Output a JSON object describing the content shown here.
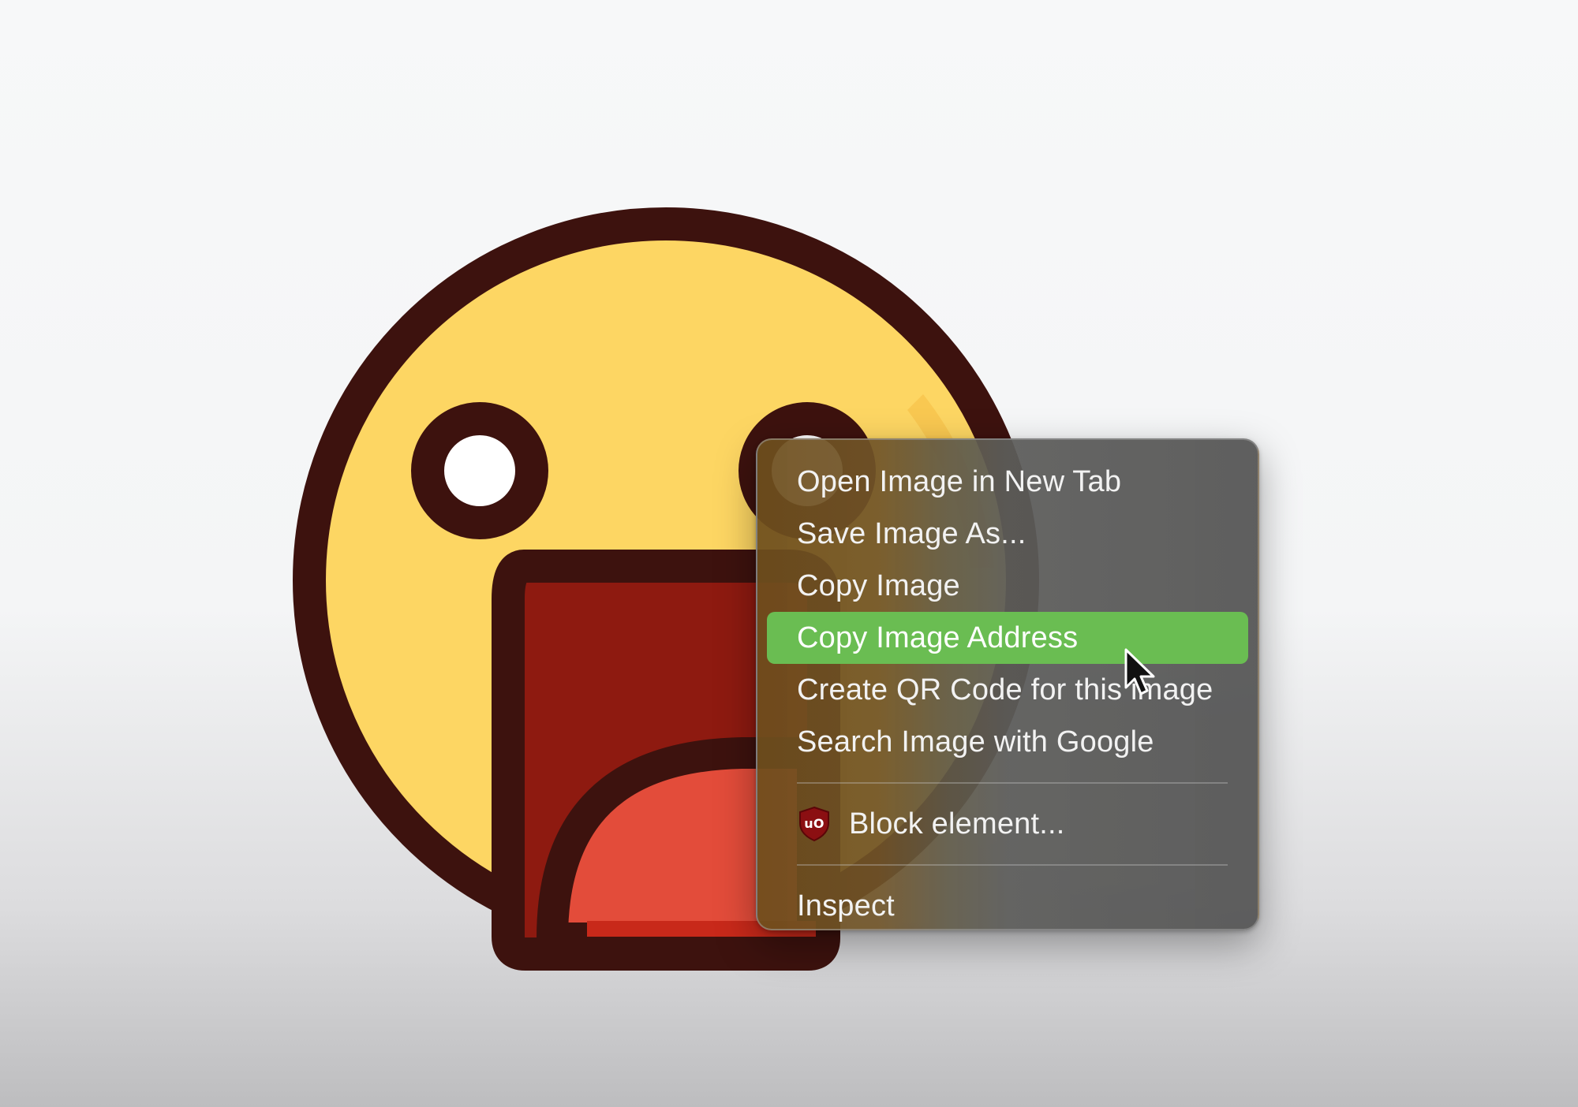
{
  "context_menu": {
    "items": [
      {
        "label": "Open Image in New Tab"
      },
      {
        "label": "Save Image As..."
      },
      {
        "label": "Copy Image"
      },
      {
        "label": "Copy Image Address",
        "highlighted": true
      },
      {
        "label": "Create QR Code for this image"
      },
      {
        "label": "Search Image with Google"
      }
    ],
    "extension_item": {
      "label": "Block element...",
      "icon": "ublock-origin-icon",
      "icon_text": "uO"
    },
    "inspect_item": {
      "label": "Inspect"
    }
  },
  "colors": {
    "highlight": "#6abd52",
    "emoji_face": "#fdd663",
    "emoji_outline": "#3d120e",
    "mouth": "#8e1a10",
    "tongue": "#e34c3a"
  },
  "icons": {
    "image": "shocked-face-emoji",
    "pointer": "mouse-pointer-icon"
  }
}
